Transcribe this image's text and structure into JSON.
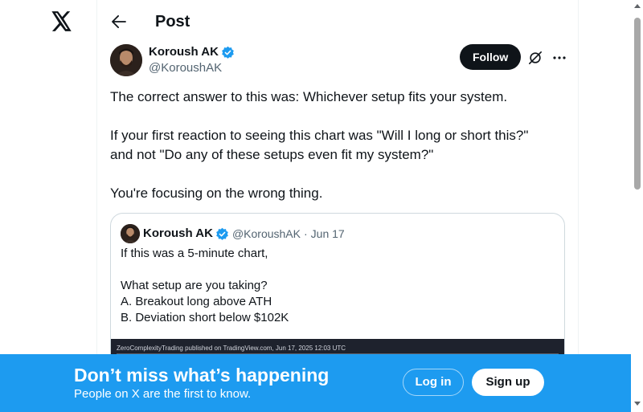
{
  "nav": {
    "logo_icon": "x-logo-icon"
  },
  "header": {
    "title": "Post",
    "back_icon": "arrow-left-icon"
  },
  "tweet": {
    "author_name": "Koroush AK",
    "author_handle": "@KoroushAK",
    "verified": true,
    "follow_label": "Follow",
    "paragraphs": [
      "The correct answer to this was: Whichever setup fits your system.",
      "",
      "If your first reaction to seeing this chart was \"Will I long or short this?\"",
      "and not \"Do any of these setups even fit my system?\"",
      "",
      "You're focusing on the wrong thing."
    ]
  },
  "quote": {
    "author_name": "Koroush AK",
    "author_handle": "@KoroushAK",
    "separator": "·",
    "date": "Jun 17",
    "paragraphs": [
      "If this was a 5-minute chart,",
      "",
      "What setup are you taking?",
      "A. Breakout long above ATH",
      "B. Deviation short below $102K"
    ],
    "chart_caption": "ZeroComplexityTrading published on TradingView.com, Jun 17, 2025 12:03 UTC"
  },
  "banner": {
    "title": "Don’t miss what’s happening",
    "subtitle": "People on X are the first to know.",
    "login_label": "Log in",
    "signup_label": "Sign up"
  },
  "colors": {
    "accent": "#1d9bf0",
    "verified": "#1d9bf0",
    "text_primary": "#0f1419",
    "text_secondary": "#536471",
    "border": "#cfd9de"
  }
}
